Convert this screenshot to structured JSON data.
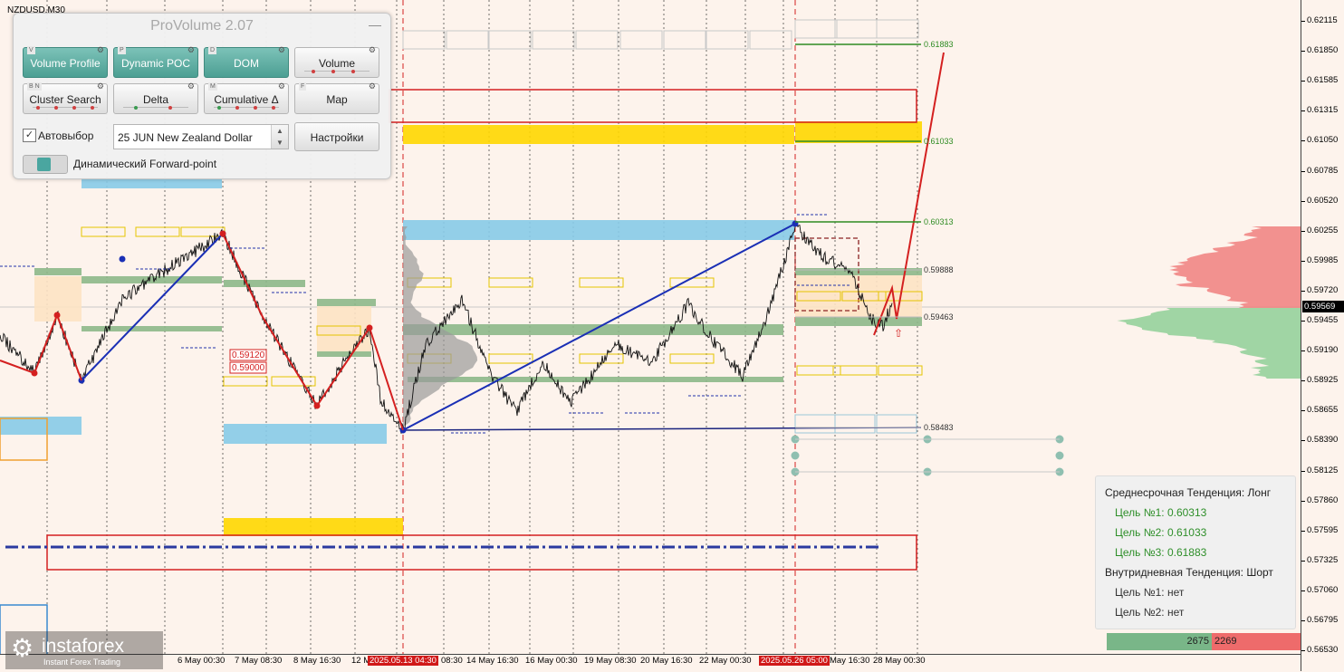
{
  "symbol": "NZDUSD,M30",
  "price_axis": {
    "ticks": [
      "0.62115",
      "0.61850",
      "0.61585",
      "0.61315",
      "0.61050",
      "0.60785",
      "0.60520",
      "0.60255",
      "0.59985",
      "0.59720",
      "0.59455",
      "0.59190",
      "0.58925",
      "0.58655",
      "0.58390",
      "0.58125",
      "0.57860",
      "0.57595",
      "0.57325",
      "0.57060",
      "0.56795",
      "0.56530"
    ],
    "current_price": "0.59569"
  },
  "time_axis": {
    "labels": [
      "6 May 00:30",
      "7 May 08:30",
      "8 May 16:30",
      "12 M",
      "2025.05.13 04:30",
      "08:30",
      "14 May 16:30",
      "16 May 00:30",
      "19 May 08:30",
      "20 May 16:30",
      "22 May 00:30",
      "2025.05.26 05:00",
      "May 16:30",
      "28 May 00:30"
    ]
  },
  "chart": {
    "level_labels": [
      "0.61883",
      "0.61033",
      "0.60313",
      "0.59888",
      "0.59463",
      "0.58483"
    ],
    "box_labels": [
      "0.59120",
      "0.59000"
    ],
    "colors": {
      "zigzag": "#d42020",
      "trend": "#1a2fb5",
      "target": "#2e8b22",
      "blue_zone": "#87cbe8",
      "yellow_zone": "#ffd700",
      "green_zone": "#8db88a"
    }
  },
  "provolume": {
    "title": "ProVolume 2.07",
    "minimize": "—",
    "buttons": [
      {
        "label": "Volume Profile",
        "hotkey": "V",
        "active": true
      },
      {
        "label": "Dynamic POC",
        "hotkey": "P",
        "active": true
      },
      {
        "label": "DOM",
        "hotkey": "D",
        "active": true
      },
      {
        "label": "Volume",
        "hotkey": "",
        "active": false
      },
      {
        "label": "Cluster Search",
        "hotkey": "B N",
        "active": false
      },
      {
        "label": "Delta",
        "hotkey": "",
        "active": false
      },
      {
        "label": "Cumulative Δ",
        "hotkey": "M",
        "active": false
      },
      {
        "label": "Map",
        "hotkey": "F",
        "active": false
      }
    ],
    "autoselect_label": "Автовыбор",
    "autoselect_checked": true,
    "contract_value": "25 JUN New Zealand Dollar",
    "settings_label": "Настройки",
    "forward_point_label": "Динамический Forward-point"
  },
  "info": {
    "mid_trend": "Среднесрочная Тенденция: Лонг",
    "target1": "Цель №1: 0.60313",
    "target2": "Цель №2: 0.61033",
    "target3": "Цель №3: 0.61883",
    "intraday_trend": "Внутридневная Тенденция: Шорт",
    "intraday_target1": "Цель №1: нет",
    "intraday_target2": "Цель №2: нет",
    "delta_buy": "2675",
    "delta_sell": "2269"
  },
  "logo": {
    "name": "instaforex",
    "tagline": "Instant Forex Trading"
  }
}
